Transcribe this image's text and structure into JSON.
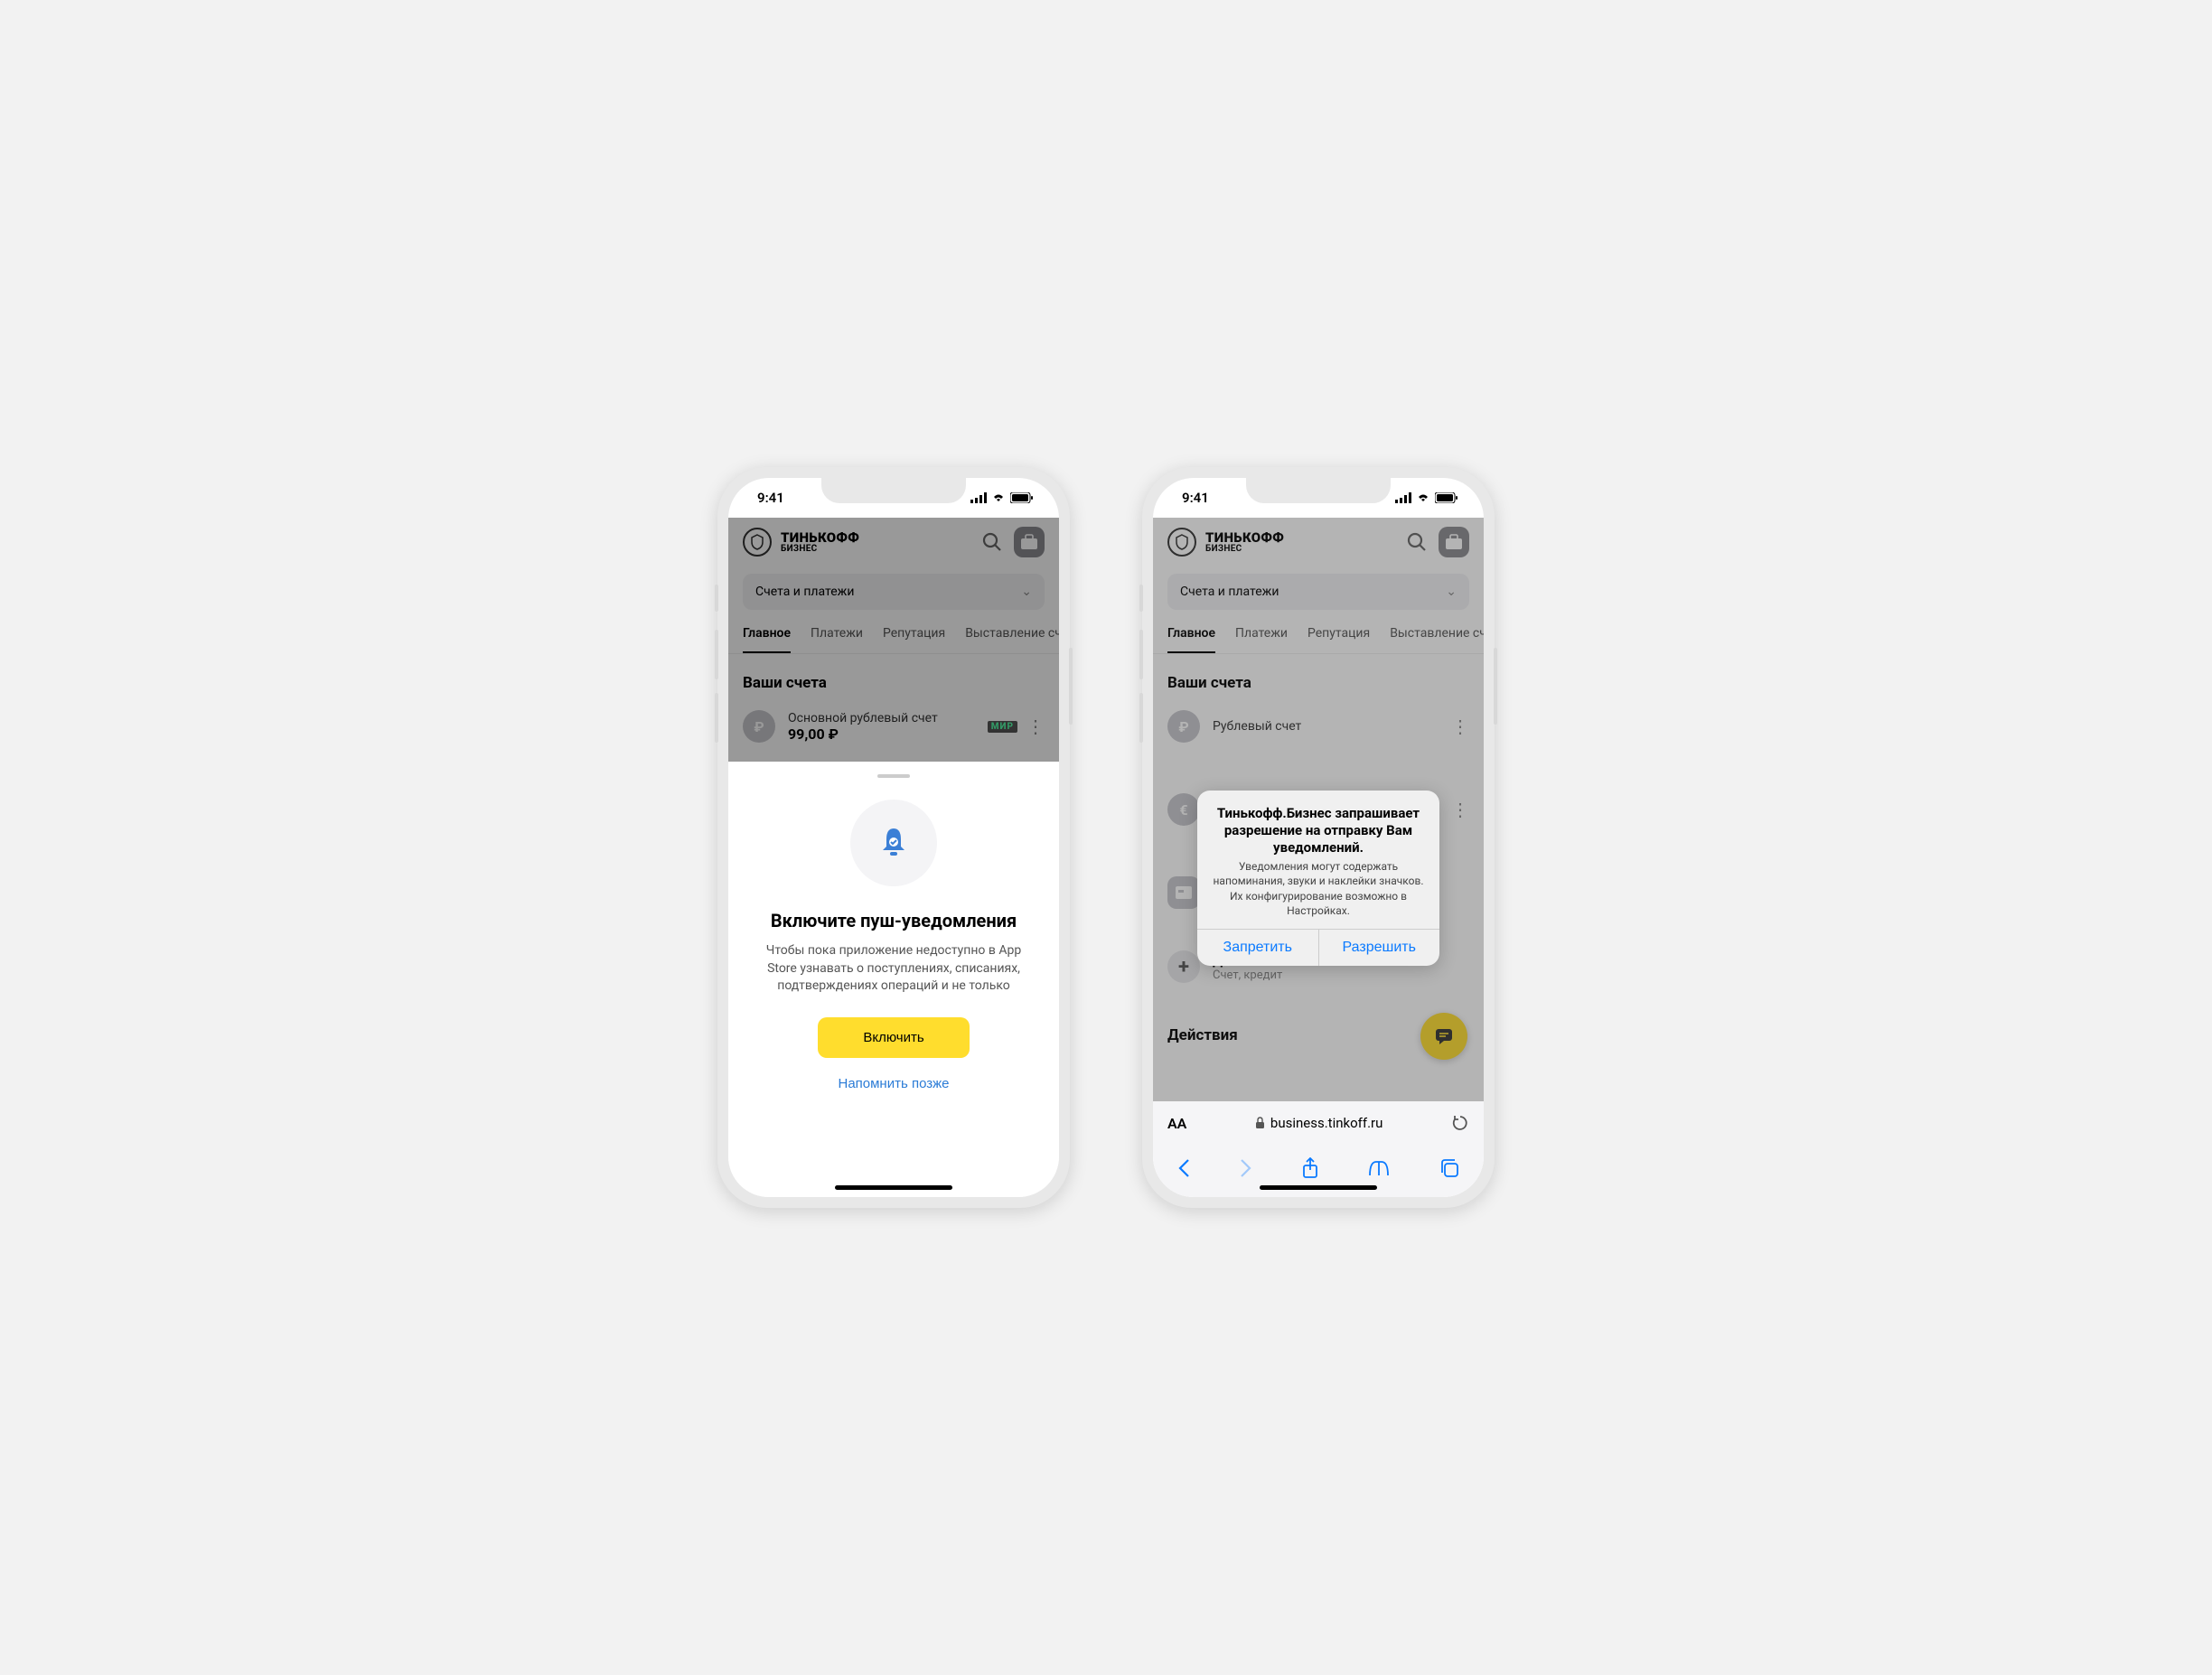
{
  "status": {
    "time": "9:41"
  },
  "brand": {
    "title": "ТИНЬКОФФ",
    "sub": "БИЗНЕС"
  },
  "selector": {
    "label": "Счета и платежи"
  },
  "tabs": [
    "Главное",
    "Платежи",
    "Репутация",
    "Выставление счета"
  ],
  "section_accounts": "Ваши счета",
  "section_actions": "Действия",
  "phone1": {
    "account": {
      "name": "Основной рублевый счет",
      "balance": "99,00 ₽"
    },
    "sheet": {
      "title": "Включите пуш-уведомления",
      "desc": "Чтобы пока приложение недоступно в App Store узнавать о поступлениях, списаниях, подтверждениях операций и не только",
      "primary": "Включить",
      "secondary": "Напомнить позже"
    }
  },
  "phone2": {
    "accounts": [
      {
        "name": "Рублевый счет"
      }
    ],
    "add": {
      "title": "Добавить новый",
      "sub": "Счет, кредит"
    },
    "alert": {
      "title": "Тинькофф.Бизнес запрашивает разрешение на отправку Вам уведомлений.",
      "msg": "Уведомления могут содержать напоминания, звуки и наклейки значков. Их конфигурирование возможно в Настройках.",
      "deny": "Запретить",
      "allow": "Разрешить"
    },
    "safari": {
      "aa": "AA",
      "url": "business.tinkoff.ru"
    }
  }
}
